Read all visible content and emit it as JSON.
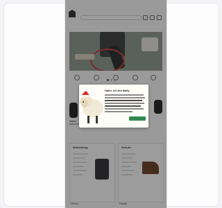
{
  "header": {
    "logo_text": "",
    "top_menu": ""
  },
  "categories": [
    {
      "label": ""
    },
    {
      "label": ""
    },
    {
      "label": ""
    },
    {
      "label": ""
    },
    {
      "label": ""
    },
    {
      "label": ""
    }
  ],
  "hero": {
    "cta_label": ""
  },
  "usps": [
    {
      "label": ""
    },
    {
      "label": ""
    },
    {
      "label": ""
    },
    {
      "label": ""
    },
    {
      "label": ""
    }
  ],
  "panels": [
    {
      "title": "Bekleidung",
      "footer": "Herren"
    },
    {
      "title": "Schuhe",
      "footer": "Frauen"
    }
  ],
  "modal": {
    "title": "Hallo, ich bin Baily",
    "link_label": "",
    "accept_label": ""
  },
  "colors": {
    "accent_red": "#c53a2e",
    "accept_green": "#2f8a4f",
    "overlay": "rgba(20,20,20,0.42)"
  }
}
